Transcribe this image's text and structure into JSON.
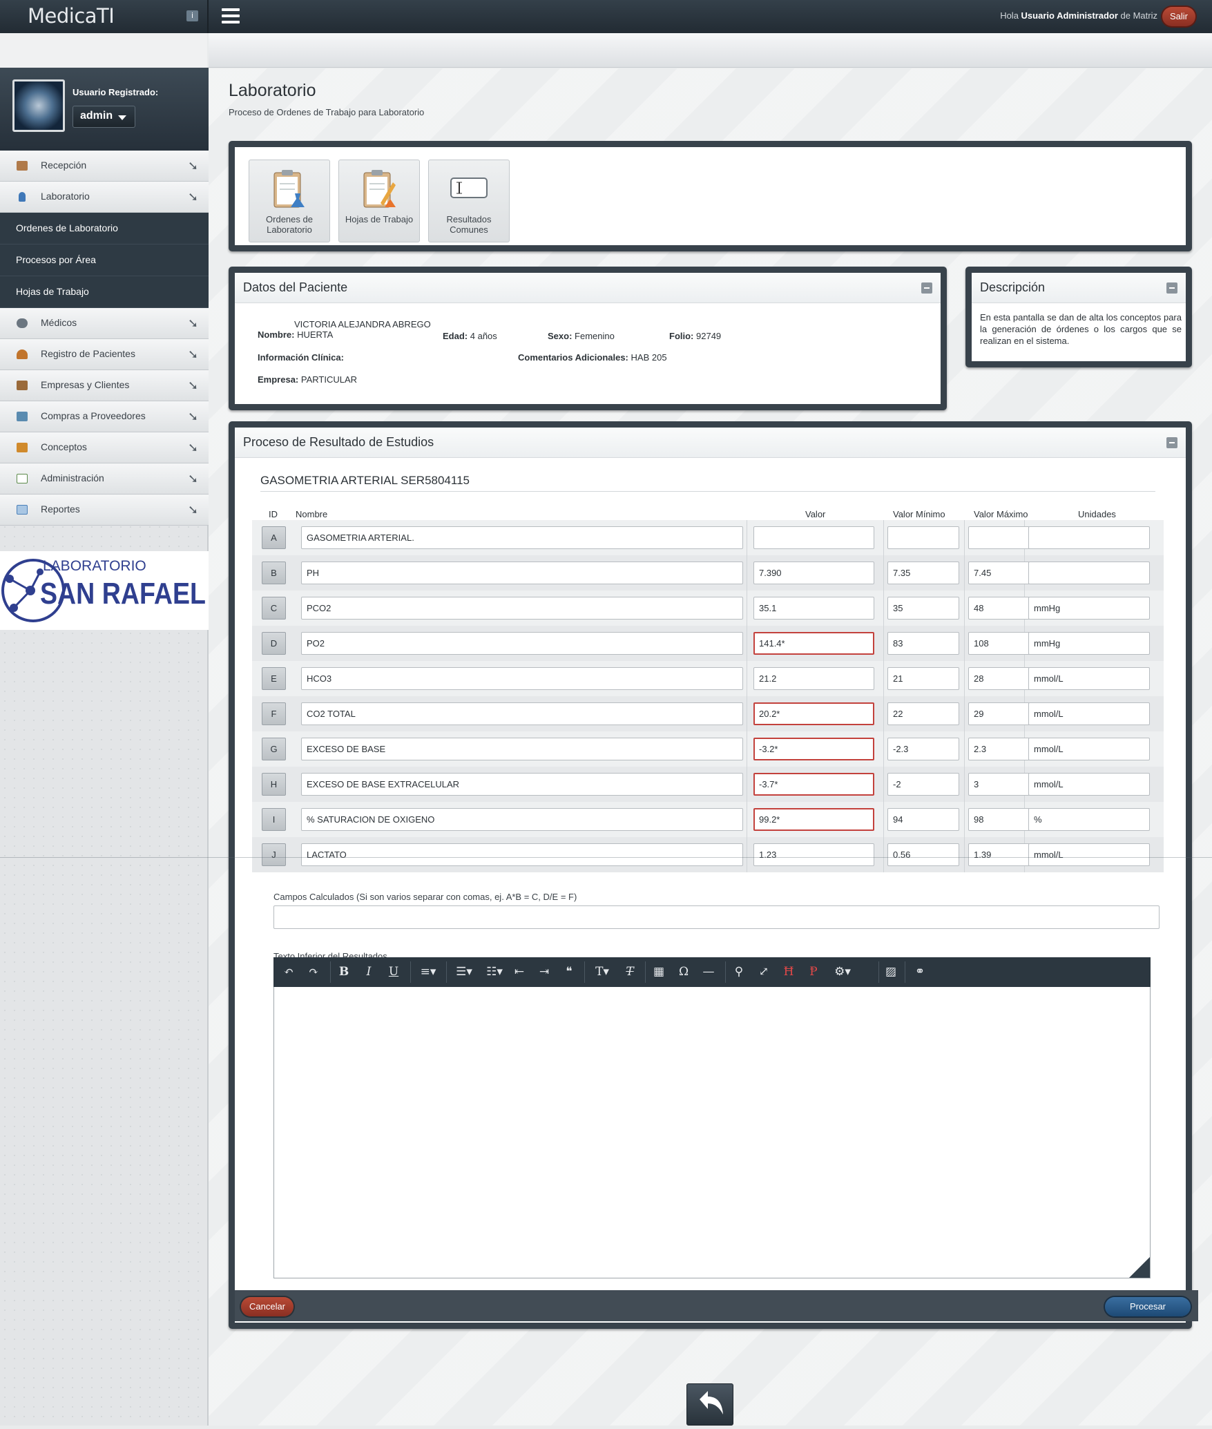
{
  "app": {
    "logo": "MedicaTI",
    "logo_badge": "i"
  },
  "topbar": {
    "greeting_prefix": "Hola ",
    "user_name": "Usuario Administrador",
    "greeting_suffix": " de Matriz",
    "logout_label": "Salir"
  },
  "user": {
    "label": "Usuario Registrado:",
    "name": "admin"
  },
  "sidebar": {
    "items": [
      {
        "label": "Recepción",
        "icon": "reception-icon",
        "color": "#b07a4a"
      },
      {
        "label": "Laboratorio",
        "icon": "flask-icon",
        "color": "#3f78b8"
      },
      {
        "label": "Médicos",
        "icon": "stethoscope-icon",
        "color": "#6b7680"
      },
      {
        "label": "Registro de Pacientes",
        "icon": "patient-icon",
        "color": "#c1742c"
      },
      {
        "label": "Empresas y Clientes",
        "icon": "building-icon",
        "color": "#9a6a3a"
      },
      {
        "label": "Compras a Proveedores",
        "icon": "purchases-icon",
        "color": "#5a8bb0"
      },
      {
        "label": "Conceptos",
        "icon": "concepts-icon",
        "color": "#d08a2c"
      },
      {
        "label": "Administración",
        "icon": "admin-icon",
        "color": "#5c8a4a"
      },
      {
        "label": "Reportes",
        "icon": "reports-icon",
        "color": "#4a7fb8"
      }
    ],
    "submenu": [
      "Ordenes de Laboratorio",
      "Procesos por Área",
      "Hojas de Trabajo"
    ]
  },
  "brand": {
    "line1": "LABORATORIO",
    "line2": "SAN RAFAEL"
  },
  "page": {
    "title": "Laboratorio",
    "subtitle": "Proceso de Ordenes de Trabajo para Laboratorio"
  },
  "toolbar": [
    {
      "label": "Ordenes de Laboratorio",
      "icon": "clipboard-flask-icon"
    },
    {
      "label": "Hojas de Trabajo",
      "icon": "clipboard-pencil-icon"
    },
    {
      "label": "Resultados Comunes",
      "icon": "text-field-icon"
    }
  ],
  "patient": {
    "title": "Datos del Paciente",
    "name_label": "Nombre:",
    "name_line1": "VICTORIA ALEJANDRA ABREGO",
    "name_line2": "HUERTA",
    "age_label": "Edad:",
    "age": "4 años",
    "sex_label": "Sexo:",
    "sex": "Femenino",
    "folio_label": "Folio:",
    "folio": "92749",
    "clinical_label": "Información Clínica:",
    "clinical": "",
    "comments_label": "Comentarios Adicionales:",
    "comments": "HAB 205",
    "company_label": "Empresa:",
    "company": "PARTICULAR"
  },
  "description": {
    "title": "Descripción",
    "text": "En esta pantalla se dan de alta los conceptos para la generación de órdenes o los cargos que se realizan en el sistema."
  },
  "results": {
    "title": "Proceso de Resultado de Estudios",
    "study": "GASOMETRIA ARTERIAL SER5804115",
    "columns": {
      "id": "ID",
      "name": "Nombre",
      "value": "Valor",
      "min": "Valor Mínimo",
      "max": "Valor Máximo",
      "units": "Unidades"
    },
    "rows": [
      {
        "id": "A",
        "name": "GASOMETRIA ARTERIAL.",
        "value": "",
        "min": "",
        "max": "",
        "units": "",
        "flag": false
      },
      {
        "id": "B",
        "name": "PH",
        "value": "7.390",
        "min": "7.35",
        "max": "7.45",
        "units": "",
        "flag": false
      },
      {
        "id": "C",
        "name": "PCO2",
        "value": "35.1",
        "min": "35",
        "max": "48",
        "units": "mmHg",
        "flag": false
      },
      {
        "id": "D",
        "name": "PO2",
        "value": "141.4*",
        "min": "83",
        "max": "108",
        "units": "mmHg",
        "flag": true
      },
      {
        "id": "E",
        "name": "HCO3",
        "value": "21.2",
        "min": "21",
        "max": "28",
        "units": "mmol/L",
        "flag": false
      },
      {
        "id": "F",
        "name": "CO2 TOTAL",
        "value": "20.2*",
        "min": "22",
        "max": "29",
        "units": "mmol/L",
        "flag": true
      },
      {
        "id": "G",
        "name": "EXCESO DE BASE",
        "value": "-3.2*",
        "min": "-2.3",
        "max": "2.3",
        "units": "mmol/L",
        "flag": true
      },
      {
        "id": "H",
        "name": "EXCESO DE BASE EXTRACELULAR",
        "value": "-3.7*",
        "min": "-2",
        "max": "3",
        "units": "mmol/L",
        "flag": true
      },
      {
        "id": "I",
        "name": "% SATURACION DE OXIGENO",
        "value": "99.2*",
        "min": "94",
        "max": "98",
        "units": "%",
        "flag": true
      },
      {
        "id": "J",
        "name": "LACTATO",
        "value": "1.23",
        "min": "0.56",
        "max": "1.39",
        "units": "mmol/L",
        "flag": false
      }
    ],
    "calc_label": "Campos Calculados (Si son varios separar con comas, ej. A*B = C, D/E = F)",
    "calc_value": "",
    "text_label": "Texto Inferior del Resultados",
    "cancel_label": "Cancelar",
    "process_label": "Procesar"
  },
  "editor_tools": [
    "undo-icon",
    "redo-icon",
    "bold-icon",
    "italic-icon",
    "underline-icon",
    "align-icon",
    "bullet-list-icon",
    "numbered-list-icon",
    "outdent-icon",
    "indent-icon",
    "blockquote-icon",
    "font-size-icon",
    "clear-format-icon",
    "table-icon",
    "special-char-icon",
    "horizontal-rule-icon",
    "find-icon",
    "fullscreen-icon",
    "html-icon",
    "paragraph-icon",
    "settings-icon",
    "image-icon",
    "attachment-icon"
  ],
  "colors": {
    "accent": "#38424b",
    "error": "#c3413c",
    "primary": "#1d4a75",
    "danger": "#8a2f22"
  }
}
